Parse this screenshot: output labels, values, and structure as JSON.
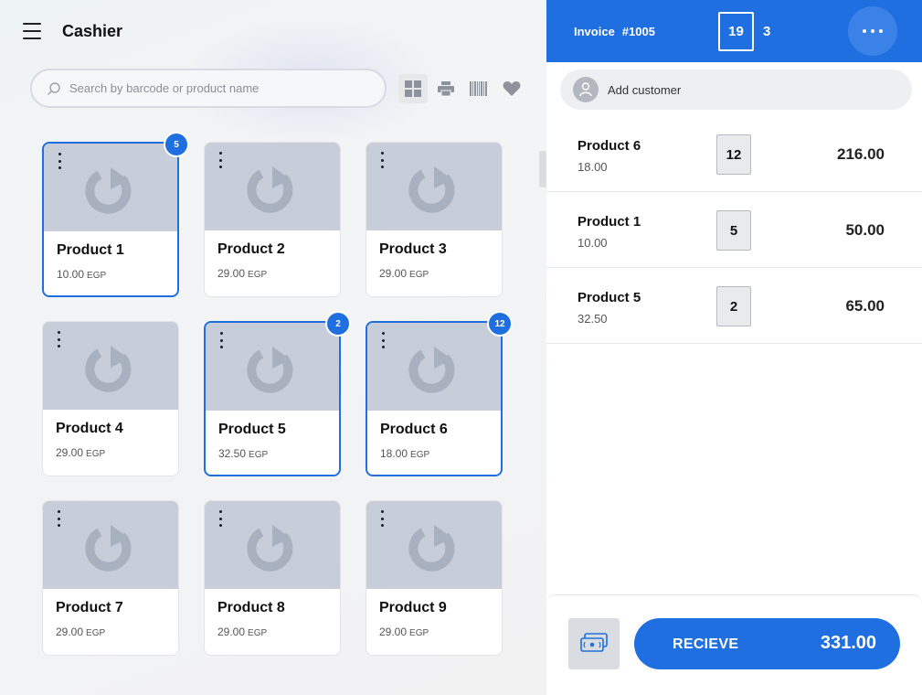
{
  "header": {
    "title": "Cashier",
    "menu_icon": "hamburger-icon"
  },
  "search": {
    "placeholder": "Search by barcode or product name",
    "value": ""
  },
  "toolbar": {
    "icons": [
      "grid-view-icon",
      "printer-icon",
      "barcode-icon",
      "heart-icon"
    ],
    "active": "grid-view-icon"
  },
  "products": [
    {
      "name": "Product 1",
      "price": "10.00",
      "currency": "EGP",
      "qty": "5",
      "selected": true
    },
    {
      "name": "Product 2",
      "price": "29.00",
      "currency": "EGP",
      "qty": "",
      "selected": false
    },
    {
      "name": "Product 3",
      "price": "29.00",
      "currency": "EGP",
      "qty": "",
      "selected": false
    },
    {
      "name": "Product 4",
      "price": "29.00",
      "currency": "EGP",
      "qty": "",
      "selected": false
    },
    {
      "name": "Product 5",
      "price": "32.50",
      "currency": "EGP",
      "qty": "2",
      "selected": true
    },
    {
      "name": "Product 6",
      "price": "18.00",
      "currency": "EGP",
      "qty": "12",
      "selected": true
    },
    {
      "name": "Product 7",
      "price": "29.00",
      "currency": "EGP",
      "qty": "",
      "selected": false
    },
    {
      "name": "Product 8",
      "price": "29.00",
      "currency": "EGP",
      "qty": "",
      "selected": false
    },
    {
      "name": "Product 9",
      "price": "29.00",
      "currency": "EGP",
      "qty": "",
      "selected": false
    }
  ],
  "invoice": {
    "label": "Invoice",
    "number": "#1005",
    "total_quantity": "19",
    "line_count": "3",
    "customer_placeholder": "Add customer",
    "lines": [
      {
        "name": "Product 6",
        "unit_price": "18.00",
        "qty": "12",
        "total": "216.00"
      },
      {
        "name": "Product 1",
        "unit_price": "10.00",
        "qty": "5",
        "total": "50.00"
      },
      {
        "name": "Product 5",
        "unit_price": "32.50",
        "qty": "2",
        "total": "65.00"
      }
    ],
    "receive_label": "RECIEVE",
    "grand_total": "331.00"
  },
  "colors": {
    "accent": "#1f6fe0",
    "placeholder_image": "#c7ced9"
  }
}
